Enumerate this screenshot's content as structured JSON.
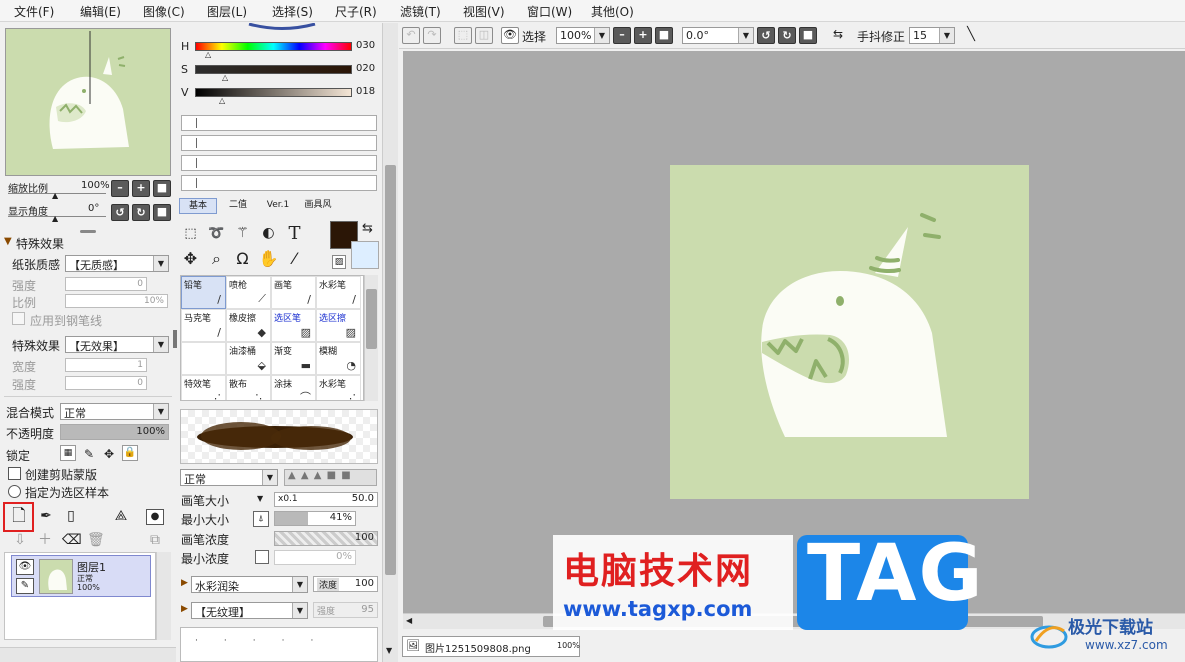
{
  "menu": [
    "文件(F)",
    "编辑(E)",
    "图像(C)",
    "图层(L)",
    "选择(S)",
    "尺子(R)",
    "滤镜(T)",
    "视图(V)",
    "窗口(W)",
    "其他(O)"
  ],
  "navigator": {
    "zoom_label": "缩放比例",
    "zoom_value": "100%",
    "angle_label": "显示角度",
    "angle_value": "0°"
  },
  "effects": {
    "header": "特殊效果",
    "paper_label": "纸张质感",
    "paper_value": "【无质感】",
    "strength_label": "强度",
    "strength_value": "0",
    "scale_label": "比例",
    "scale_value": "10%",
    "apply_to_line": "应用到钢笔线",
    "effect_label": "特殊效果",
    "effect_value": "【无效果】",
    "width_label": "宽度",
    "width_value": "1",
    "strength2_label": "强度",
    "strength2_value": "0"
  },
  "layer_props": {
    "blend_label": "混合模式",
    "blend_value": "正常",
    "opacity_label": "不透明度",
    "opacity_value": "100%",
    "opacity_fraction": 1.0,
    "lock_label": "锁定",
    "clip_label": "创建剪贴蒙版",
    "sample_label": "指定为选区样本"
  },
  "layers": [
    {
      "name": "图层1",
      "mode": "正常",
      "opacity": "100%"
    }
  ],
  "color": {
    "h_label": "H",
    "h_value": "030",
    "s_label": "S",
    "s_value": "020",
    "v_label": "V",
    "v_value": "018",
    "primary": "#2b1606",
    "secondary": "#ddeeff"
  },
  "tool_tabs": [
    "基本",
    "二值",
    "Ver.1",
    "画具风"
  ],
  "brushes": [
    {
      "name": "铅笔",
      "selected": true
    },
    {
      "name": "喷枪"
    },
    {
      "name": "画笔"
    },
    {
      "name": "水彩笔"
    },
    {
      "name": "马克笔"
    },
    {
      "name": "橡皮擦"
    },
    {
      "name": "选区笔",
      "blue": true
    },
    {
      "name": "选区擦",
      "blue": true
    },
    {
      "name": ""
    },
    {
      "name": "油漆桶"
    },
    {
      "name": "渐变"
    },
    {
      "name": "模糊"
    },
    {
      "name": "特效笔"
    },
    {
      "name": "散布"
    },
    {
      "name": "涂抹"
    },
    {
      "name": "水彩笔"
    }
  ],
  "brush_settings": {
    "mode_value": "正常",
    "size_label": "画笔大小",
    "size_mult": "x0.1",
    "size_value": "50.0",
    "min_size_label": "最小大小",
    "min_size_value": "41%",
    "min_size_fraction": 0.41,
    "density_label": "画笔浓度",
    "density_value": "100",
    "min_density_label": "最小浓度",
    "min_density_value": "0%",
    "blend_value": "水彩润染",
    "blend_strength_label": "浓度",
    "blend_strength_value": "100",
    "texture_value": "【无纹理】",
    "texture_strength_label": "强度",
    "texture_strength_value": "95"
  },
  "toolbar": {
    "selection_label": "选择",
    "zoom_value": "100%",
    "angle_value": "0.0°",
    "stabilizer_label": "手抖修正",
    "stabilizer_value": "15"
  },
  "status": {
    "file_name": "图片1251509808.png",
    "zoom": "100%"
  },
  "watermark": {
    "site_cn": "电脑技术网",
    "url": "www.tagxp.com",
    "tag": "TAG",
    "corner_text": "极光下载站",
    "corner_url": "www.xz7.com"
  },
  "colors": {
    "canvas_bg": "#aaaaaa",
    "art_bg": "#cbdcae",
    "monster": "#fbfcf5",
    "monster_detail": "#8fb06b",
    "tag_blue": "#1c86e8",
    "watermark_red": "#e02020"
  }
}
